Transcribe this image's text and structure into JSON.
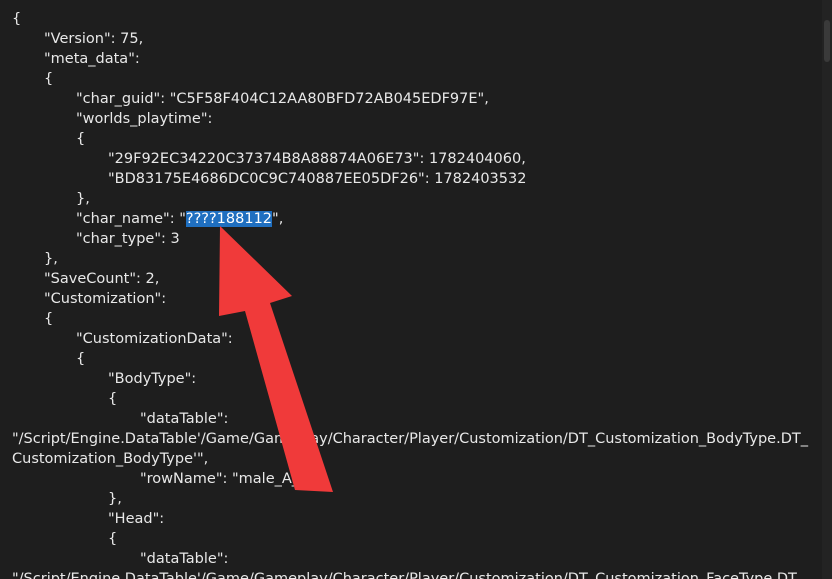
{
  "lines": [
    "{",
    "\"Version\": 75,",
    "\"meta_data\":",
    "{",
    "\"char_guid\": \"C5F58F404C12AA80BFD72AB045EDF97E\",",
    "\"worlds_playtime\":",
    "{",
    "\"29F92EC34220C37374B8A88874A06E73\": 1782404060,",
    "\"BD83175E4686DC0C9C740887EE05DF26\": 1782403532",
    "},",
    "\"char_name\": \"",
    "\",",
    "\"char_type\": 3",
    "},",
    "\"SaveCount\": 2,",
    "\"Customization\":",
    "{",
    "\"CustomizationData\":",
    "{",
    "\"BodyType\":",
    "{",
    "\"dataTable\":",
    "\"/Script/Engine.DataTable'/Game/Gameplay/Character/Player/Customization/DT_Customization_BodyType.DT_",
    "Customization_BodyType'\",",
    "\"rowName\": \"male_A_01\"",
    "},",
    "\"Head\":",
    "{",
    "\"dataTable\":",
    "\"/Script/Engine.DataTable'/Game/Gameplay/Character/Player/Customization/DT_Customization_FaceType.DT_"
  ],
  "selected_text": "????188112",
  "colors": {
    "background": "#1e1e1e",
    "text": "#e8e8e8",
    "selection": "#1f6fc0",
    "arrow": "#f03a3a"
  },
  "icons": {
    "annotation": "red-arrow-icon"
  }
}
